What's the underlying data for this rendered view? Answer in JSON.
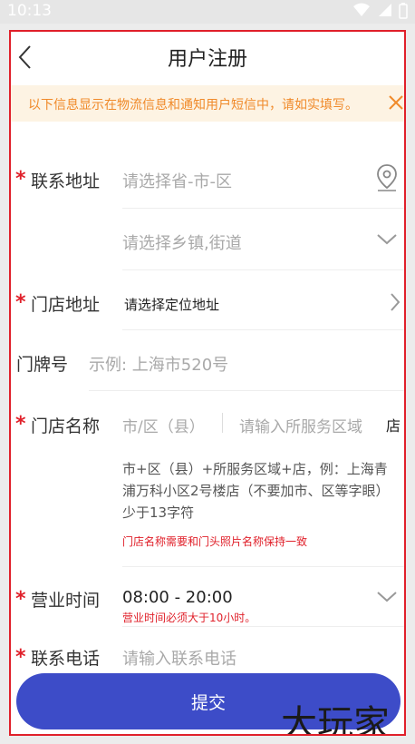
{
  "status_bar": {
    "time": "10:13"
  },
  "header": {
    "title": "用户注册"
  },
  "notice": {
    "text": "以下信息显示在物流信息和通知用户短信中，请如实填写。"
  },
  "form": {
    "address": {
      "label": "联系地址",
      "province_placeholder": "请选择省-市-区",
      "street_placeholder": "请选择乡镇,街道"
    },
    "store_address": {
      "label": "门店地址",
      "value": "请选择定位地址"
    },
    "door_number": {
      "label": "门牌号",
      "placeholder": "示例: 上海市520号"
    },
    "store_name": {
      "label": "门店名称",
      "district_placeholder": "市/区（县）",
      "area_placeholder": "请输入所服务区域",
      "suffix": "店",
      "hint": "市+区（县）+所服务区域+店，例：上海青浦万科小区2号楼店（不要加市、区等字眼）少于13字符",
      "warning": "门店名称需要和门头照片名称保持一致"
    },
    "business_hours": {
      "label": "营业时间",
      "value": "08:00 - 20:00",
      "warning": "营业时间必须大于10小时。"
    },
    "phone": {
      "label": "联系电话",
      "placeholder": "请输入联系电话"
    },
    "required_mark": "*"
  },
  "submit": {
    "label": "提交"
  },
  "watermark": {
    "text": "大玩家"
  },
  "colors": {
    "accent": "#3d4cc8",
    "required": "#e0202a",
    "notice_bg": "#fdf3e3",
    "notice_text": "#f08a2a"
  }
}
